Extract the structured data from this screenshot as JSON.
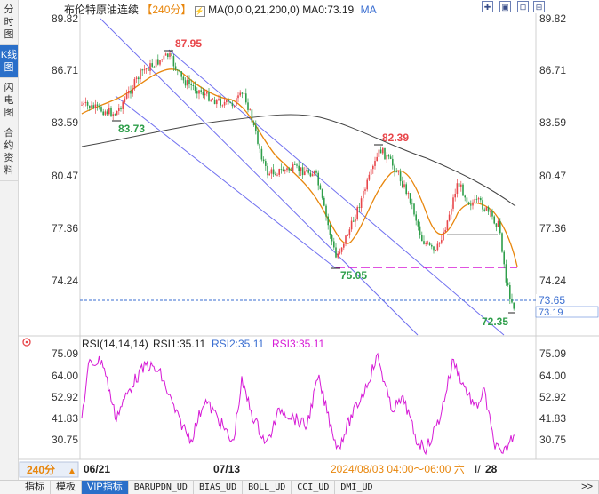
{
  "sidebar": {
    "tabs": [
      {
        "label": "分时图",
        "active": false
      },
      {
        "label": "K线图",
        "active": true
      },
      {
        "label": "闪电图",
        "active": false
      },
      {
        "label": "合约资料",
        "active": false
      }
    ]
  },
  "header": {
    "instrument": "布伦特原油连续",
    "period": "240分",
    "ma_label": "MA(0,0,0,21,200,0)",
    "ma0_label": "MA0:73.19",
    "ma_link": "MA"
  },
  "price_axis": {
    "ticks": [
      "89.82",
      "86.71",
      "83.59",
      "80.47",
      "77.36",
      "74.24"
    ],
    "last_price": "73.65",
    "last_close": "73.19"
  },
  "annotations": {
    "high1": "87.95",
    "low1": "83.73",
    "high2": "82.39",
    "low2": "75.05",
    "low3": "72.35"
  },
  "rsi": {
    "label": "RSI(14,14,14)",
    "rsi1": "RSI1:35.11",
    "rsi2": "RSI2:35.11",
    "rsi3": "RSI3:35.11",
    "ticks": [
      "75.09",
      "64.00",
      "52.92",
      "41.83",
      "30.75"
    ]
  },
  "time_axis": {
    "period_button": "240分",
    "date1": "06/21",
    "date2": "07/13",
    "cursor_time": "2024/08/03 04:00～06:00 六",
    "date3": "28"
  },
  "bottom_tabs": [
    "指标",
    "模板",
    "VIP指标",
    "BARUPDN_UD",
    "BIAS_UD",
    "BOLL_UD",
    "CCI_UD",
    "DMI_UD"
  ],
  "bottom_nav": ">>",
  "colors": {
    "up": "#e8464a",
    "down": "#2e9e4a",
    "ma21": "#e8860c",
    "ma200": "#444444",
    "channel": "#6f6ff0",
    "support": "#d61ad6",
    "rsi": "#d61ad6",
    "accent": "#2a6fc9"
  },
  "icons": [
    "lightning-icon",
    "zoom-in-icon",
    "zoom-out-icon",
    "fullscreen-icon",
    "restore-icon"
  ]
}
